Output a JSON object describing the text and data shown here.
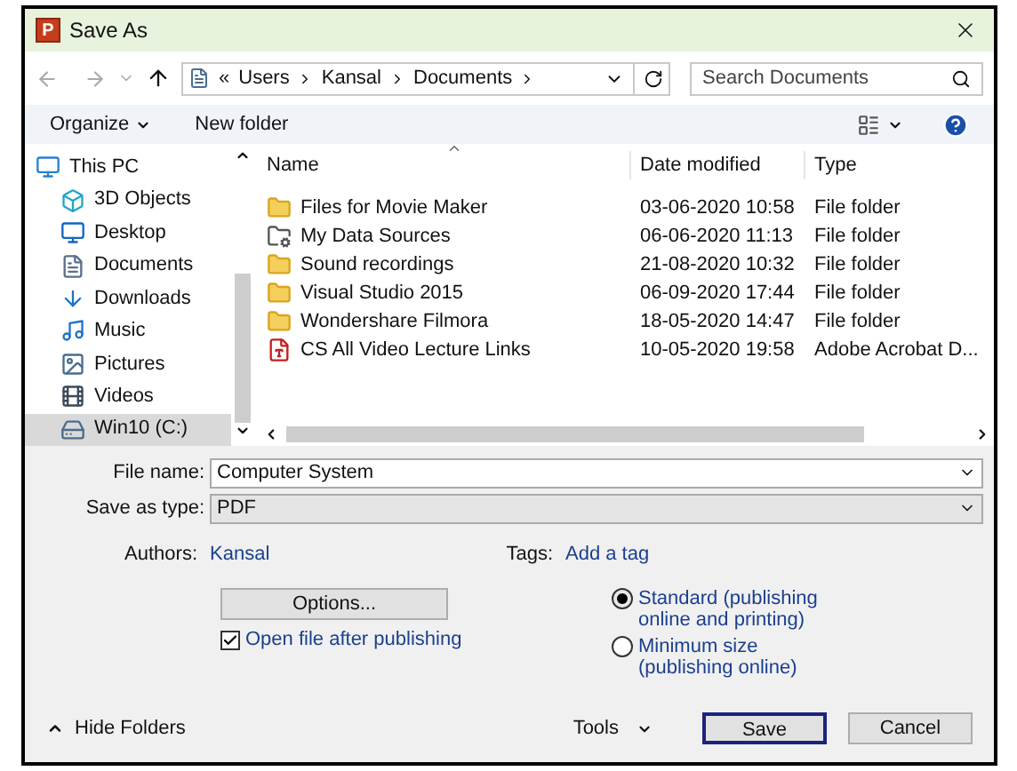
{
  "window": {
    "title": "Save As",
    "app_icon_letter": "P"
  },
  "address": {
    "lead": "«",
    "segments": [
      "Users",
      "Kansal",
      "Documents"
    ]
  },
  "search": {
    "placeholder": "Search Documents"
  },
  "toolbar": {
    "organize": "Organize",
    "new_folder": "New folder"
  },
  "sidebar": {
    "items": [
      {
        "label": "This PC",
        "kind": "pc",
        "selected": false,
        "children": [
          {
            "label": "3D Objects",
            "kind": "cube",
            "selected": false
          },
          {
            "label": "Desktop",
            "kind": "desktop",
            "selected": false
          },
          {
            "label": "Documents",
            "kind": "document",
            "selected": false
          },
          {
            "label": "Downloads",
            "kind": "download",
            "selected": false
          },
          {
            "label": "Music",
            "kind": "music",
            "selected": false
          },
          {
            "label": "Pictures",
            "kind": "pictures",
            "selected": false
          },
          {
            "label": "Videos",
            "kind": "video",
            "selected": false
          },
          {
            "label": "Win10 (C:)",
            "kind": "drive",
            "selected": true
          }
        ]
      }
    ]
  },
  "table": {
    "columns": [
      "Name",
      "Date modified",
      "Type"
    ],
    "rows": [
      {
        "name": "Files for Movie Maker",
        "date": "03-06-2020 10:58",
        "type": "File folder",
        "kind": "folder"
      },
      {
        "name": "My Data Sources",
        "date": "06-06-2020 11:13",
        "type": "File folder",
        "kind": "special"
      },
      {
        "name": "Sound recordings",
        "date": "21-08-2020 10:32",
        "type": "File folder",
        "kind": "folder"
      },
      {
        "name": "Visual Studio 2015",
        "date": "06-09-2020 17:44",
        "type": "File folder",
        "kind": "folder"
      },
      {
        "name": "Wondershare Filmora",
        "date": "18-05-2020 14:47",
        "type": "File folder",
        "kind": "folder"
      },
      {
        "name": "CS All Video Lecture Links",
        "date": "10-05-2020 19:58",
        "type": "Adobe Acrobat D...",
        "kind": "pdf"
      }
    ]
  },
  "form": {
    "file_name": {
      "label": "File name:",
      "value": "Computer System"
    },
    "save_type": {
      "label": "Save as type:",
      "value": "PDF"
    },
    "authors": {
      "label": "Authors:",
      "value": "Kansal"
    },
    "tags": {
      "label": "Tags:",
      "value": "Add a tag"
    },
    "options_button": "Options...",
    "open_after": {
      "label": "Open file after publishing",
      "checked": true
    },
    "optimize": [
      {
        "label": "Standard (publishing online and printing)",
        "selected": true
      },
      {
        "label": "Minimum size (publishing online)",
        "selected": false
      }
    ]
  },
  "footer": {
    "hide_folders": "Hide Folders",
    "tools": "Tools",
    "buttons": [
      "Save",
      "Cancel"
    ]
  }
}
